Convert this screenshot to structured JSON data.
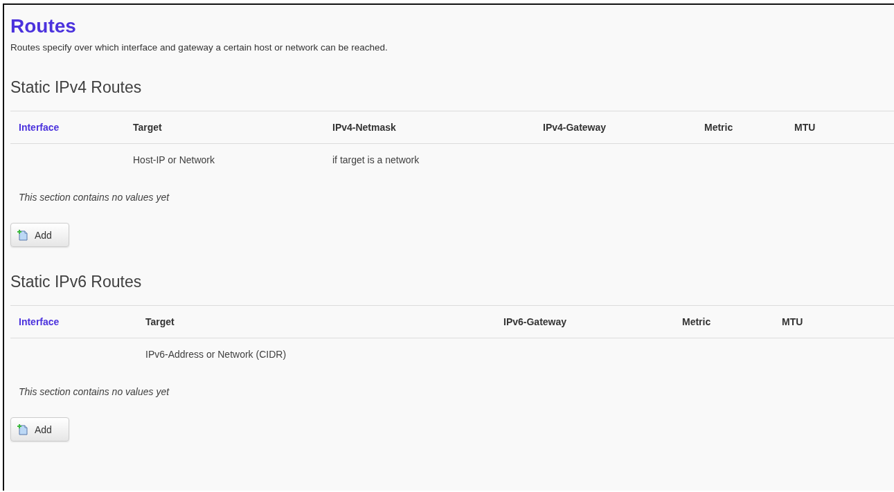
{
  "page": {
    "title": "Routes",
    "description": "Routes specify over which interface and gateway a certain host or network can be reached."
  },
  "sections": [
    {
      "kind": "ipv4",
      "title": "Static IPv4 Routes",
      "columns": [
        {
          "label": "Interface",
          "sortable": true
        },
        {
          "label": "Target",
          "sortable": false,
          "hint": "Host-IP or Network"
        },
        {
          "label": "IPv4-Netmask",
          "sortable": false,
          "hint": "if target is a network"
        },
        {
          "label": "IPv4-Gateway",
          "sortable": false
        },
        {
          "label": "Metric",
          "sortable": false
        },
        {
          "label": "MTU",
          "sortable": false
        }
      ],
      "empty_message": "This section contains no values yet",
      "add_button": "Add"
    },
    {
      "kind": "ipv6",
      "title": "Static IPv6 Routes",
      "columns": [
        {
          "label": "Interface",
          "sortable": true
        },
        {
          "label": "Target",
          "sortable": false,
          "hint": "IPv6-Address or Network (CIDR)"
        },
        {
          "label": "IPv6-Gateway",
          "sortable": false
        },
        {
          "label": "Metric",
          "sortable": false
        },
        {
          "label": "MTU",
          "sortable": false
        }
      ],
      "empty_message": "This section contains no values yet",
      "add_button": "Add"
    }
  ]
}
